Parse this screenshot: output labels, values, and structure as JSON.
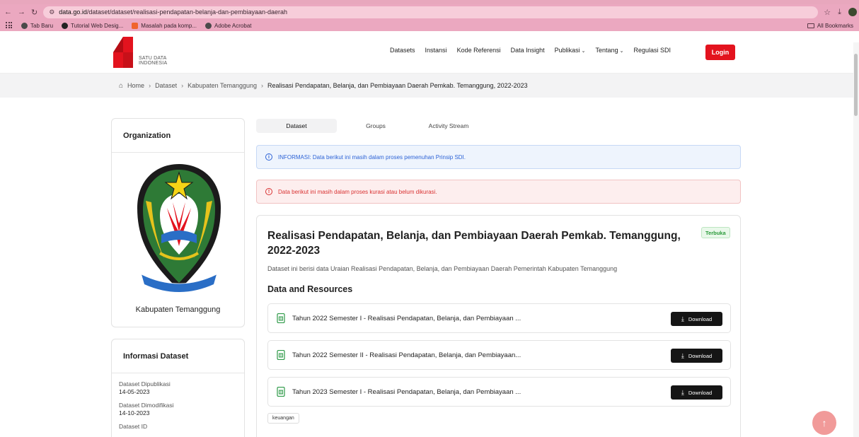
{
  "browser": {
    "url_domain": "data.go.id",
    "url_path": "/dataset/dataset/realisasi-pendapatan-belanja-dan-pembiayaan-daerah",
    "bookmarks": [
      "Tab Baru",
      "Tutorial Web Desig...",
      "Masalah pada komp...",
      "Adobe Acrobat"
    ],
    "all_bookmarks": "All Bookmarks"
  },
  "header": {
    "logo_line1": "SATU DATA",
    "logo_line2": "INDONESIA",
    "nav": [
      "Datasets",
      "Instansi",
      "Kode Referensi",
      "Data Insight",
      "Publikasi",
      "Tentang",
      "Regulasi SDI"
    ],
    "login": "Login",
    "brand_color": "#e3131e"
  },
  "breadcrumb": {
    "home": "Home",
    "dataset": "Dataset",
    "org": "Kabupaten Temanggung",
    "current": "Realisasi Pendapatan, Belanja, dan Pembiayaan Daerah Pemkab. Temanggung, 2022-2023"
  },
  "sidebar": {
    "org_title": "Organization",
    "emblem_text": "SWADAYA BHUMI PHALA KABUPATEN TEMANGGUNG",
    "org_name": "Kabupaten Temanggung",
    "info_title": "Informasi Dataset",
    "info": [
      {
        "label": "Dataset Dipublikasi",
        "value": "14-05-2023"
      },
      {
        "label": "Dataset Dimodifikasi",
        "value": "14-10-2023"
      },
      {
        "label": "Dataset ID",
        "value": ""
      }
    ]
  },
  "tabs": [
    "Dataset",
    "Groups",
    "Activity Stream"
  ],
  "alerts": {
    "info": "INFORMASI: Data berikut ini masih dalam proses pemenuhan Prinsip SDI.",
    "warning": "Data berikut ini masih dalam proses kurasi atau belum dikurasi."
  },
  "dataset": {
    "title": "Realisasi Pendapatan, Belanja, dan Pembiayaan Daerah Pemkab. Temanggung, 2022-2023",
    "badge": "Terbuka",
    "description": "Dataset ini berisi data Uraian Realisasi Pendapatan, Belanja, dan Pembiayaan Daerah Pemerintah Kabupaten Temanggung",
    "resources_heading": "Data and Resources",
    "resources": [
      {
        "name": "Tahun 2022 Semester I - Realisasi Pendapatan, Belanja, dan Pembiayaan ...",
        "action": "Download"
      },
      {
        "name": "Tahun 2022 Semester II - Realisasi Pendapatan, Belanja, dan Pembiayaan...",
        "action": "Download"
      },
      {
        "name": "Tahun 2023 Semester I - Realisasi Pendapatan, Belanja, dan Pembiayaan ...",
        "action": "Download"
      }
    ],
    "tags": [
      "keuangan"
    ]
  }
}
